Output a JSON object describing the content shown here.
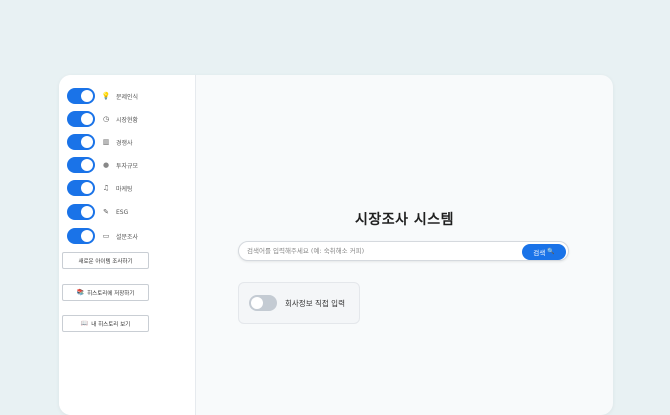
{
  "sidebar": {
    "toggles": [
      {
        "label": "문제인식",
        "icon": "lightbulb-icon",
        "glyph": "💡",
        "on": true
      },
      {
        "label": "시장현황",
        "icon": "clock-icon",
        "glyph": "◷",
        "on": true
      },
      {
        "label": "경쟁사",
        "icon": "building-icon",
        "glyph": "▥",
        "on": true
      },
      {
        "label": "투자규모",
        "icon": "circle-icon",
        "glyph": "●",
        "on": true
      },
      {
        "label": "마케팅",
        "icon": "music-note-icon",
        "glyph": "♫",
        "on": true
      },
      {
        "label": "ESG",
        "icon": "pencil-icon",
        "glyph": "✎",
        "on": true
      },
      {
        "label": "설문조사",
        "icon": "chat-icon",
        "glyph": "▭",
        "on": true
      }
    ],
    "buttons": {
      "new_item": {
        "label": "새로운 아이템 조사하기"
      },
      "save_history": {
        "label": "히스토리에 저장하기",
        "glyph": "📚"
      },
      "view_history": {
        "label": "내 히스토리 보기",
        "glyph": "📖"
      }
    }
  },
  "main": {
    "title": "시장조사 시스템",
    "search": {
      "placeholder": "검색어를 입력해주세요 (예: 숙취해소 커피)",
      "value": "",
      "button_label": "검색",
      "button_glyph": "🔍"
    },
    "company_card": {
      "label": "회사정보 직접 입력",
      "on": false
    }
  },
  "colors": {
    "accent": "#1a73e8",
    "toggle_off": "#c4cbd3"
  }
}
